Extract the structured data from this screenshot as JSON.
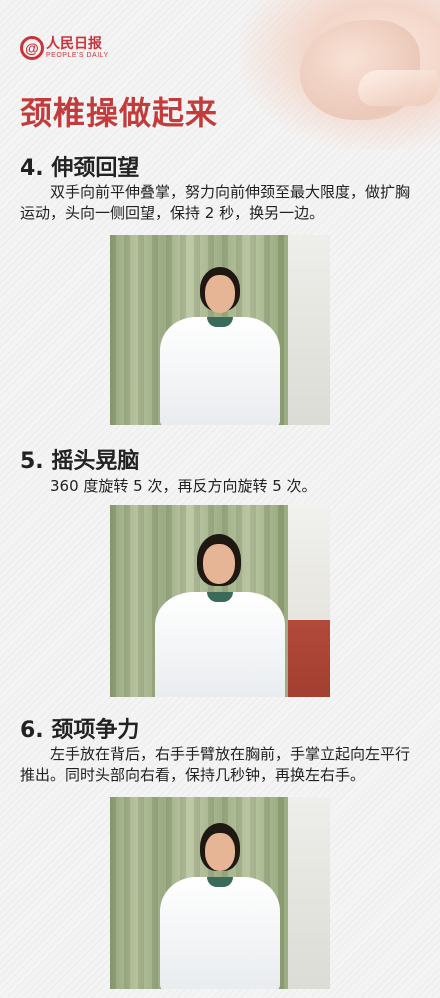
{
  "logo": {
    "mark": "@",
    "name_cn": "人民日报",
    "name_en": "PEOPLE'S DAILY"
  },
  "title": "颈椎操做起来",
  "sections": [
    {
      "heading": "4. 伸颈回望",
      "text": "　　双手向前平伸叠掌，努力向前伸颈至最大限度，做扩胸运动，头向一侧回望，保持 2 秒，换另一边。"
    },
    {
      "heading": "5. 摇头晃脑",
      "text": "　　360 度旋转 5 次，再反方向旋转 5 次。"
    },
    {
      "heading": "6. 颈项争力",
      "text": "　　左手放在背后，右手手臂放在胸前，手掌立起向左平行推出。同时头部向右看，保持几秒钟，再换左右手。"
    }
  ],
  "colors": {
    "brand_red": "#c9343a",
    "title_red": "#c43b3b",
    "curtain_green": "#a4b388",
    "coat_white": "#ffffff"
  }
}
